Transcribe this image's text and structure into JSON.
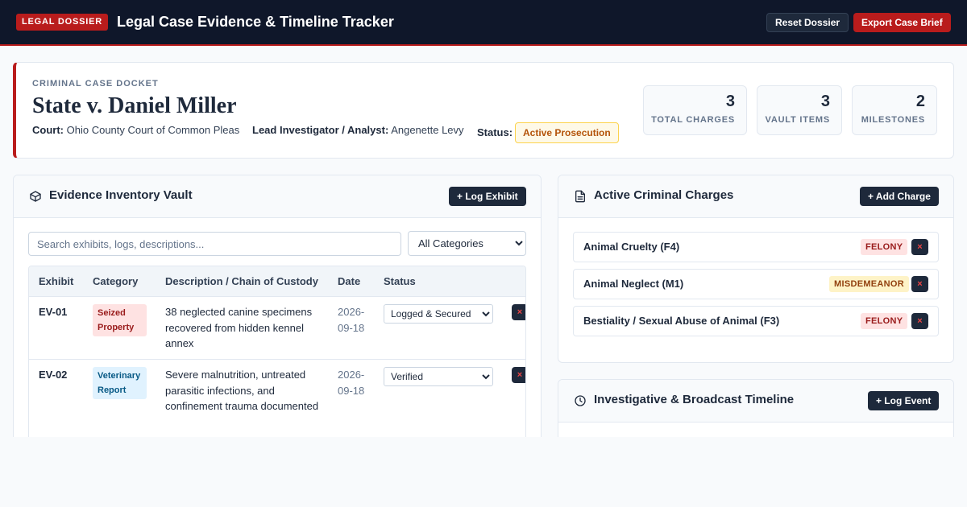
{
  "header": {
    "badge": "LEGAL DOSSIER",
    "title": "Legal Case Evidence & Timeline Tracker",
    "reset_label": "Reset Dossier",
    "export_label": "Export Case Brief"
  },
  "docket": {
    "kicker": "CRIMINAL CASE DOCKET",
    "case_title": "State v. Daniel Miller",
    "court_label": "Court:",
    "court_value": "Ohio County Court of Common Pleas",
    "lead_label": "Lead Investigator / Analyst:",
    "lead_value": "Angenette Levy",
    "status_label": "Status:",
    "status_value": "Active Prosecution",
    "stats": [
      {
        "num": "3",
        "label": "TOTAL CHARGES"
      },
      {
        "num": "3",
        "label": "VAULT ITEMS"
      },
      {
        "num": "2",
        "label": "MILESTONES"
      }
    ]
  },
  "evidence": {
    "title": "Evidence Inventory Vault",
    "add_label": "+ Log Exhibit",
    "search_placeholder": "Search exhibits, logs, descriptions...",
    "category_filter": "All Categories",
    "columns": [
      "Exhibit",
      "Category",
      "Description / Chain of Custody",
      "Date",
      "Status"
    ],
    "rows": [
      {
        "id": "EV-01",
        "category": "Seized Property",
        "description": "38 neglected canine specimens recovered from hidden kennel annex",
        "date": "2026-09-18",
        "status": "Logged & Secured",
        "delete": "×"
      },
      {
        "id": "EV-02",
        "category": "Veterinary Report",
        "description": "Severe malnutrition, untreated parasitic infections, and confinement trauma documented",
        "date": "2026-09-18",
        "status": "Verified",
        "delete": "×"
      }
    ]
  },
  "charges": {
    "title": "Active Criminal Charges",
    "add_label": "+ Add Charge",
    "items": [
      {
        "name": "Animal Cruelty (F4)",
        "tag": "FELONY",
        "delete": "×"
      },
      {
        "name": "Animal Neglect (M1)",
        "tag": "MISDEMEANOR",
        "delete": "×"
      },
      {
        "name": "Bestiality / Sexual Abuse of Animal (F3)",
        "tag": "FELONY",
        "delete": "×"
      }
    ]
  },
  "timeline": {
    "title": "Investigative & Broadcast Timeline",
    "add_label": "+ Log Event"
  },
  "colors": {
    "accent_red": "#b91c1c",
    "navy": "#0f172a",
    "slate": "#1e293b"
  }
}
